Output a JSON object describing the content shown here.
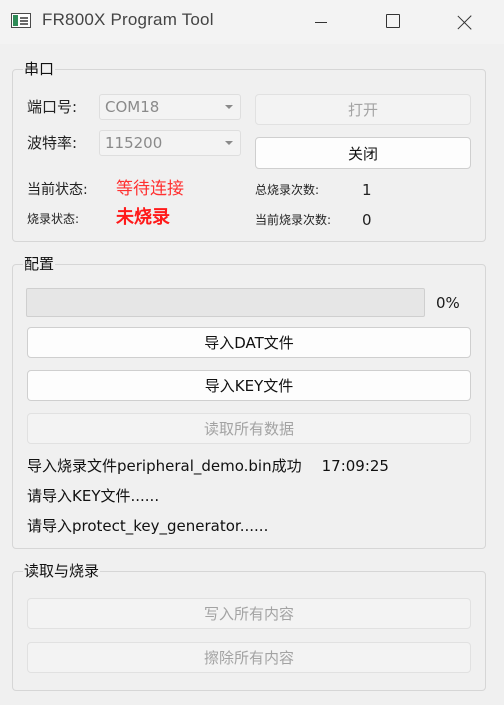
{
  "window": {
    "title": "FR800X Program Tool",
    "buttons": [
      "minimize",
      "maximize",
      "close"
    ]
  },
  "serial": {
    "group_title": "串口",
    "port_label": "端口号:",
    "port_value": "COM18",
    "baud_label": "波特率:",
    "baud_value": "115200",
    "open_button": "打开",
    "close_button": "关闭",
    "state_label": "当前状态:",
    "state_value": "等待连接",
    "burn_state_label": "烧录状态:",
    "burn_state_value": "未烧录",
    "total_count_label": "总烧录次数:",
    "total_count_value": "1",
    "current_count_label": "当前烧录次数:",
    "current_count_value": "0"
  },
  "config": {
    "group_title": "配置",
    "progress_percent": 0,
    "progress_text": "0%",
    "import_dat_button": "导入DAT文件",
    "import_key_button": "导入KEY文件",
    "read_all_button": "读取所有数据",
    "log": [
      {
        "text": "导入烧录文件peripheral_demo.bin成功",
        "time": "17:09:25"
      },
      {
        "text": "请导入KEY文件......"
      },
      {
        "text": "请导入protect_key_generator......"
      }
    ]
  },
  "read_burn": {
    "group_title": "读取与烧录",
    "write_all_button": "写入所有内容",
    "erase_all_button": "擦除所有内容"
  },
  "colors": {
    "status_red": "#ff1a1a",
    "background": "#f0f0f0"
  }
}
